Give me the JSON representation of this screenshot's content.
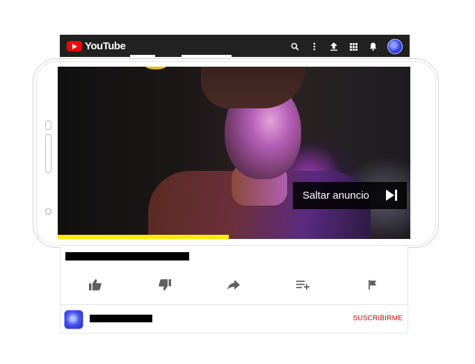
{
  "header": {
    "logo_text": "YouTube",
    "logo_color": "#ff0000",
    "background": "#212121",
    "icons": [
      "search-icon",
      "more-vert-icon",
      "upload-icon",
      "apps-grid-icon",
      "notifications-bell-icon",
      "account-avatar"
    ]
  },
  "video": {
    "skip_ad_label": "Saltar anuncio",
    "skip_icon": "skip-next-icon",
    "ad_progress_fraction": 0.485,
    "progress_color": "#ffea00"
  },
  "actions": [
    "like-icon",
    "dislike-icon",
    "share-icon",
    "add-to-playlist-icon",
    "report-flag-icon"
  ],
  "channel": {
    "subscribe_label": "SUSCRIBIRME",
    "subscribe_color": "#cc0000"
  }
}
